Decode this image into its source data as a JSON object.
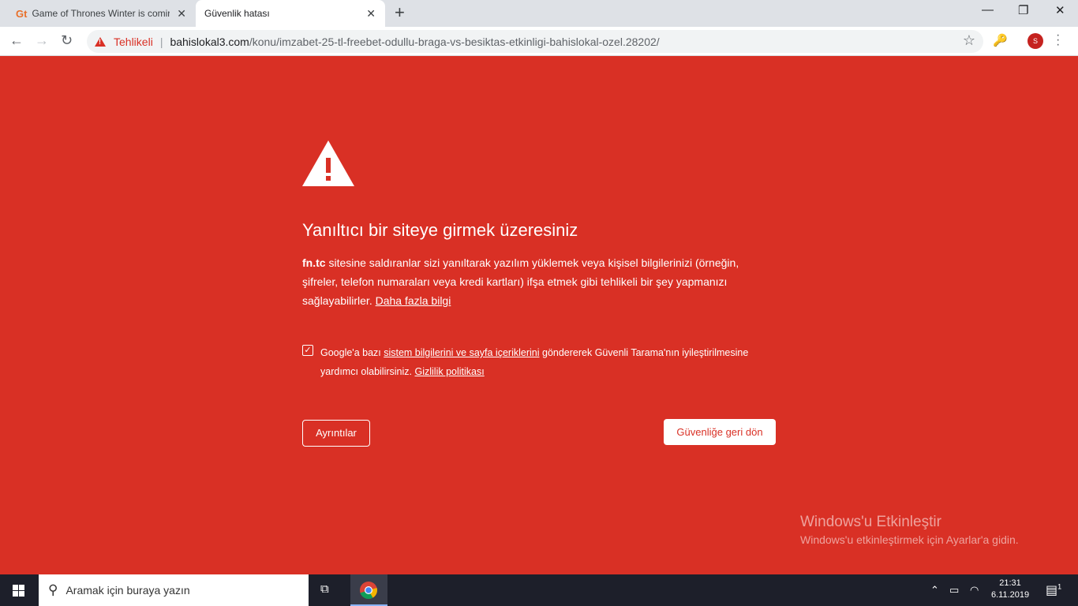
{
  "browser": {
    "tabs": [
      {
        "favicon": "Gt",
        "title": "Game of Thrones Winter is comir"
      },
      {
        "title": "Güvenlik hatası"
      }
    ],
    "security_label": "Tehlikeli",
    "url_host": "bahislokal3.com",
    "url_path": "/konu/imzabet-25-tl-freebet-odullu-braga-vs-besiktas-etkinligi-bahislokal-ozel.28202/",
    "profile_initial": "S"
  },
  "interstitial": {
    "heading": "Yanıltıcı bir siteye girmek üzeresiniz",
    "site": "fn.tc",
    "explanation": " sitesine saldıranlar sizi yanıltarak yazılım yüklemek veya kişisel bilgilerinizi (örneğin, şifreler, telefon numaraları veya kredi kartları) ifşa etmek gibi tehlikeli bir şey yapmanızı sağlayabilirler. ",
    "learn_more": "Daha fazla bilgi",
    "optin_prefix": "Google'a bazı ",
    "optin_link": "sistem bilgilerini ve sayfa içeriklerini",
    "optin_middle": " göndererek Güvenli Tarama'nın iyileştirilmesine yardımcı olabilirsiniz. ",
    "privacy_link": "Gizlilik politikası",
    "details_button": "Ayrıntılar",
    "back_button": "Güvenliğe geri dön"
  },
  "activation": {
    "title": "Windows'u Etkinleştir",
    "subtitle": "Windows'u etkinleştirmek için Ayarlar'a gidin."
  },
  "taskbar": {
    "search_placeholder": "Aramak için buraya yazın",
    "time": "21:31",
    "date": "6.11.2019",
    "notification_count": "1"
  }
}
